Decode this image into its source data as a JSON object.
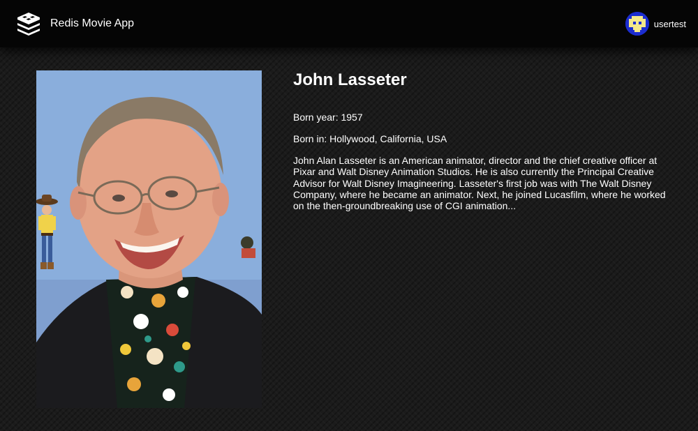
{
  "header": {
    "app_name": "Redis Movie App",
    "logo_icon": "redis-stack-logo-icon",
    "user": {
      "name": "usertest",
      "avatar_icon": "pixel-avatar-icon"
    }
  },
  "person": {
    "name": "John Lasseter",
    "born_year": "Born year: 1957",
    "born_in": "Born in: Hollywood, California, USA",
    "bio": "John Alan Lasseter is an American animator, director and the chief creative officer at Pixar and Walt Disney Animation Studios. He is also currently the Principal Creative Advisor for Walt Disney Imagineering. Lasseter's first job was with The Walt Disney Company, where he became an animator. Next, he joined Lucasfilm, where he worked on the then-groundbreaking use of CGI animation..."
  },
  "colors": {
    "background": "#1b1b1b",
    "topbar": "#050505",
    "text": "#ffffff",
    "avatar": "#1c2dd0",
    "avatar_pixels": "#f5e88a"
  }
}
